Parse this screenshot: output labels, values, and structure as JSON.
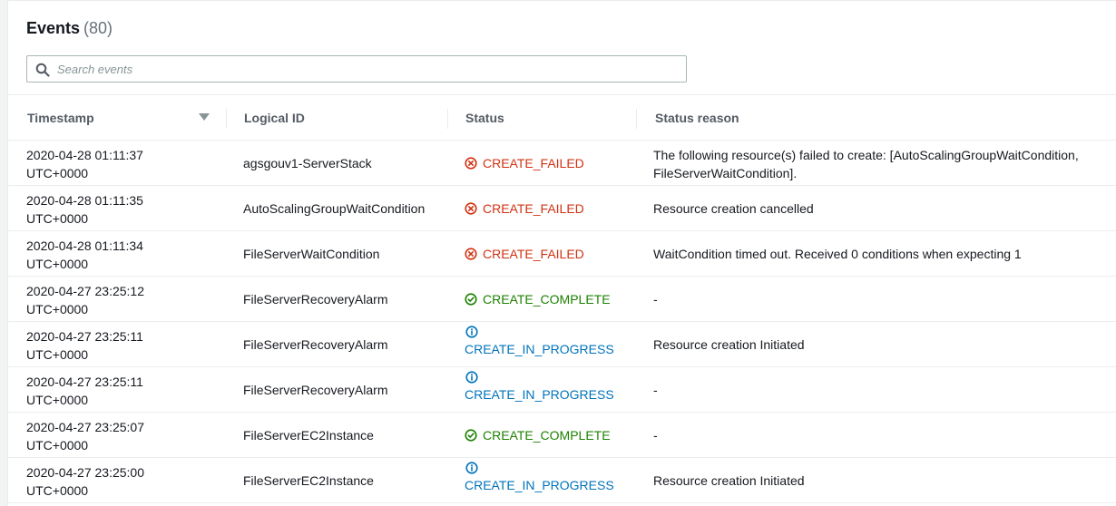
{
  "events": {
    "title": "Events",
    "count": "(80)",
    "search_placeholder": "Search events",
    "columns": {
      "timestamp": "Timestamp",
      "logical_id": "Logical ID",
      "status": "Status",
      "status_reason": "Status reason"
    },
    "rows": [
      {
        "ts_date": "2020-04-28 01:11:37",
        "ts_tz": "UTC+0000",
        "logical_id": "agsgouv1-ServerStack",
        "status": "CREATE_FAILED",
        "reason_1": "The following resource(s) failed to create: [AutoScalingGroupWaitCondition,",
        "reason_2": "FileServerWaitCondition]."
      },
      {
        "ts_date": "2020-04-28 01:11:35",
        "ts_tz": "UTC+0000",
        "logical_id": "AutoScalingGroupWaitCondition",
        "status": "CREATE_FAILED",
        "reason_1": "Resource creation cancelled",
        "reason_2": ""
      },
      {
        "ts_date": "2020-04-28 01:11:34",
        "ts_tz": "UTC+0000",
        "logical_id": "FileServerWaitCondition",
        "status": "CREATE_FAILED",
        "reason_1": "WaitCondition timed out. Received 0 conditions when expecting 1",
        "reason_2": ""
      },
      {
        "ts_date": "2020-04-27 23:25:12",
        "ts_tz": "UTC+0000",
        "logical_id": "FileServerRecoveryAlarm",
        "status": "CREATE_COMPLETE",
        "reason_1": "-",
        "reason_2": ""
      },
      {
        "ts_date": "2020-04-27 23:25:11",
        "ts_tz": "UTC+0000",
        "logical_id": "FileServerRecoveryAlarm",
        "status": "CREATE_IN_PROGRESS",
        "reason_1": "Resource creation Initiated",
        "reason_2": ""
      },
      {
        "ts_date": "2020-04-27 23:25:11",
        "ts_tz": "UTC+0000",
        "logical_id": "FileServerRecoveryAlarm",
        "status": "CREATE_IN_PROGRESS",
        "reason_1": "-",
        "reason_2": ""
      },
      {
        "ts_date": "2020-04-27 23:25:07",
        "ts_tz": "UTC+0000",
        "logical_id": "FileServerEC2Instance",
        "status": "CREATE_COMPLETE",
        "reason_1": "-",
        "reason_2": ""
      },
      {
        "ts_date": "2020-04-27 23:25:00",
        "ts_tz": "UTC+0000",
        "logical_id": "FileServerEC2Instance",
        "status": "CREATE_IN_PROGRESS",
        "reason_1": "Resource creation Initiated",
        "reason_2": ""
      }
    ]
  },
  "colors": {
    "failed": "#d13212",
    "complete": "#1d8102",
    "in_progress": "#0073bb"
  },
  "icons": {
    "search": "search-icon",
    "failed": "x-circle-icon",
    "complete": "check-circle-icon",
    "in_progress": "info-circle-icon",
    "sort": "sort-descending-icon"
  }
}
